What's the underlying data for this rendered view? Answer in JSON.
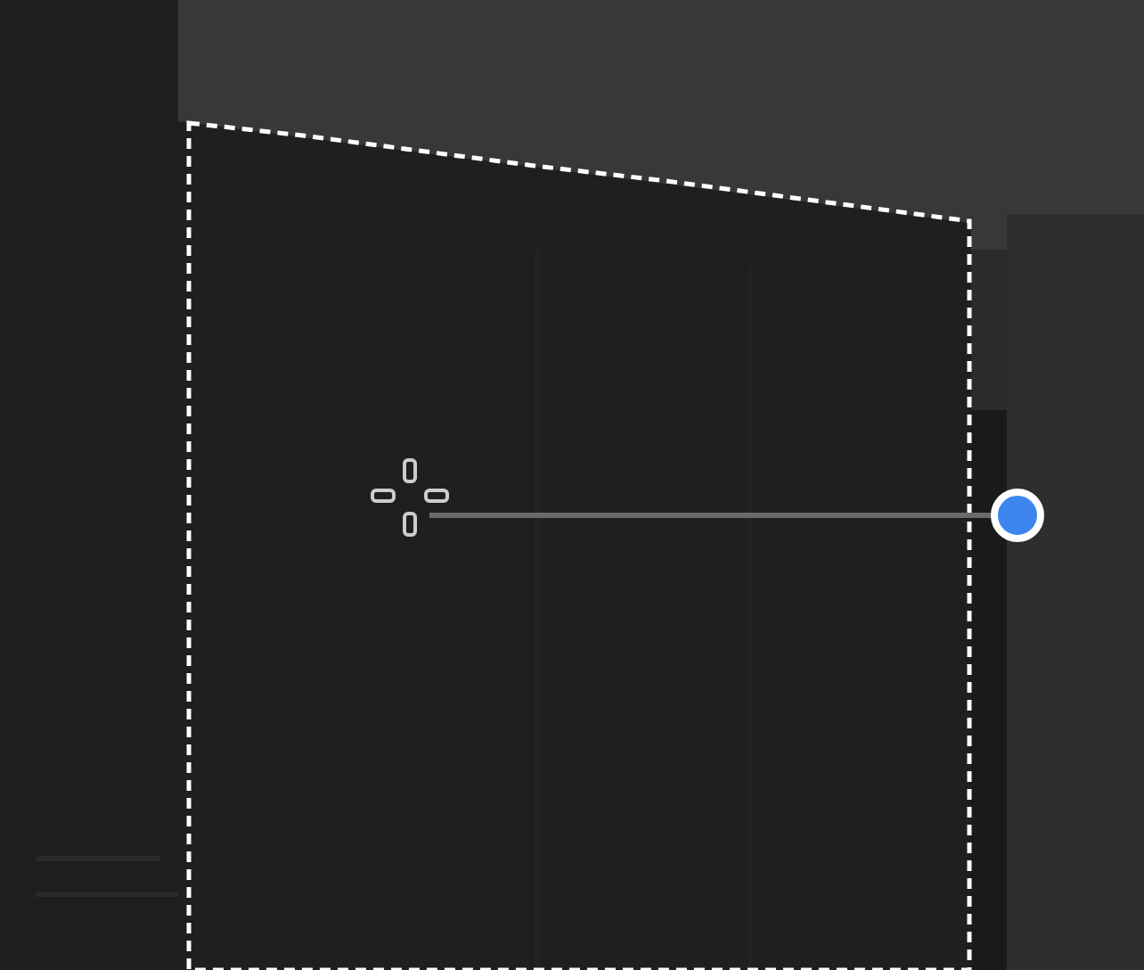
{
  "canvas": {
    "selection": {
      "kind": "polygon"
    }
  }
}
